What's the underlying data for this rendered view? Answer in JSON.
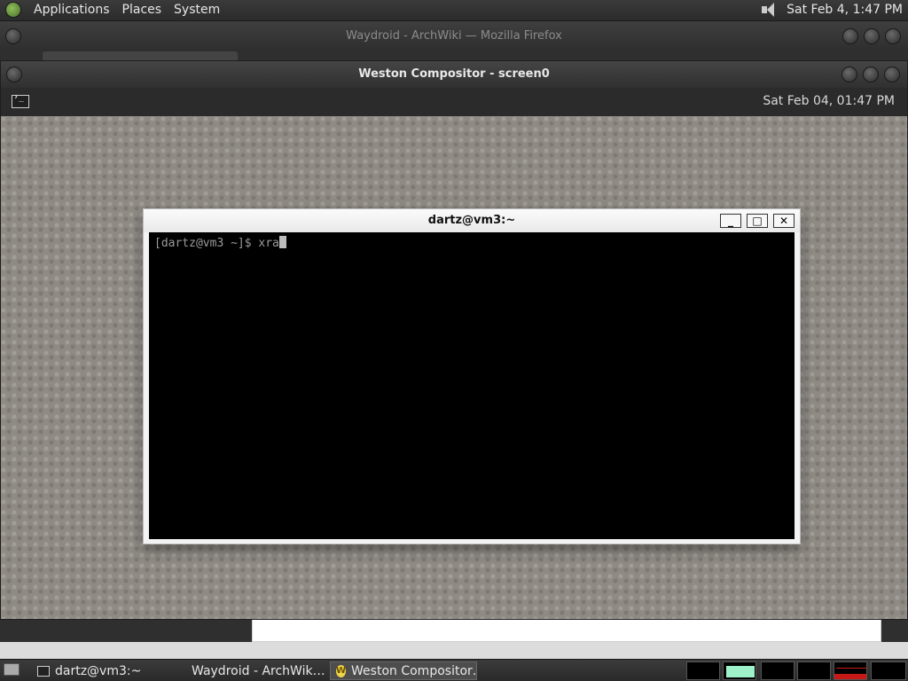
{
  "top_panel": {
    "menus": [
      "Applications",
      "Places",
      "System"
    ],
    "clock": "Sat Feb  4,  1:47 PM"
  },
  "firefox_window": {
    "title": "Waydroid - ArchWiki — Mozilla Firefox"
  },
  "weston_window": {
    "title": "Weston Compositor - screen0",
    "panel_clock": "Sat Feb 04, 01:47 PM"
  },
  "terminal": {
    "title": "dartz@vm3:~",
    "prompt": "[dartz@vm3 ~]$ ",
    "input": "xra",
    "buttons": {
      "minimize": "_",
      "maximize": "□",
      "close": "✕"
    }
  },
  "taskbar": {
    "tasks": [
      {
        "label": "dartz@vm3:~",
        "icon": "terminal-icon"
      },
      {
        "label": "Waydroid - ArchWik…",
        "icon": "firefox-icon"
      },
      {
        "label": "Weston Compositor…",
        "icon": "weston-icon",
        "active": true
      }
    ],
    "workspaces": 6
  }
}
